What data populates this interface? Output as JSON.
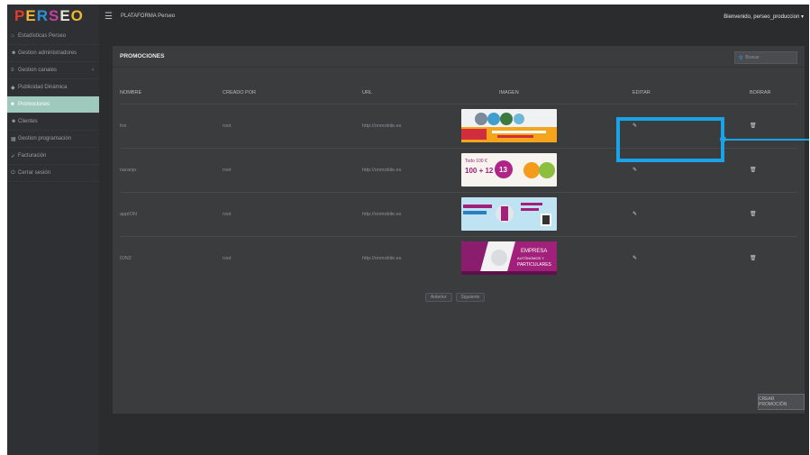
{
  "brand": {
    "logo_letters": [
      "P",
      "E",
      "R",
      "S",
      "E",
      "O"
    ],
    "logo_colors": [
      "#e23b2f",
      "#f2b632",
      "#2f8fd6",
      "#c63fa0",
      "#e7e1d9",
      "#f2b632"
    ]
  },
  "header": {
    "app_title": "PLATAFORMA Perseo",
    "welcome": "Bienvenido, perseo_produccion ▾"
  },
  "sidebar": {
    "items": [
      {
        "label": "Estadísticas Perseo",
        "icon": "home-icon",
        "glyph": "⌂",
        "active": false
      },
      {
        "label": "Gestion administradores",
        "icon": "users-icon",
        "glyph": "☻",
        "active": false
      },
      {
        "label": "Gestion canales",
        "icon": "list-icon",
        "glyph": "≡",
        "active": false,
        "caret": "‹"
      },
      {
        "label": "Publicidad Dinámica",
        "icon": "tag-icon",
        "glyph": "◆",
        "active": false
      },
      {
        "label": "Promociones",
        "icon": "gift-icon",
        "glyph": "■",
        "active": true
      },
      {
        "label": "Clientes",
        "icon": "clients-icon",
        "glyph": "☻",
        "active": false
      },
      {
        "label": "Gestion programación",
        "icon": "calendar-icon",
        "glyph": "▦",
        "active": false
      },
      {
        "label": "Facturación",
        "icon": "rocket-icon",
        "glyph": "➶",
        "active": false
      },
      {
        "label": "Cerrar sesión",
        "icon": "power-icon",
        "glyph": "⏻",
        "active": false
      }
    ]
  },
  "panel": {
    "title": "PROMOCIONES",
    "search_placeholder": "Buscar"
  },
  "table": {
    "headers": [
      "NOMBRE",
      "CREADO POR",
      "URL",
      "IMAGEN",
      "EDITAR",
      "BORRAR"
    ],
    "rows": [
      {
        "name": "fox",
        "creator": "root",
        "url": "http://onmobile.es"
      },
      {
        "name": "naranjo",
        "creator": "root",
        "url": "http://onmobile.es"
      },
      {
        "name": "appION",
        "creator": "root",
        "url": "http://onmobile.es"
      },
      {
        "name": "ION2",
        "creator": "root",
        "url": "http://onmobile.es"
      }
    ],
    "edit_icon": "edit-icon",
    "delete_icon": "trash-icon"
  },
  "banners": {
    "b2": {
      "line1": "Todo 100 €",
      "line2": "100 + 12",
      "line3": "13"
    },
    "b4": {
      "line1": "EMPRESA",
      "line2": "AUTÓNOMOS Y",
      "line3": "PARTICULARES"
    }
  },
  "pager": {
    "prev": "Anterior",
    "next": "Siguiente"
  },
  "create_button": "CREAR PROMOCIÓN",
  "annotation_color": "#1aa3e8"
}
